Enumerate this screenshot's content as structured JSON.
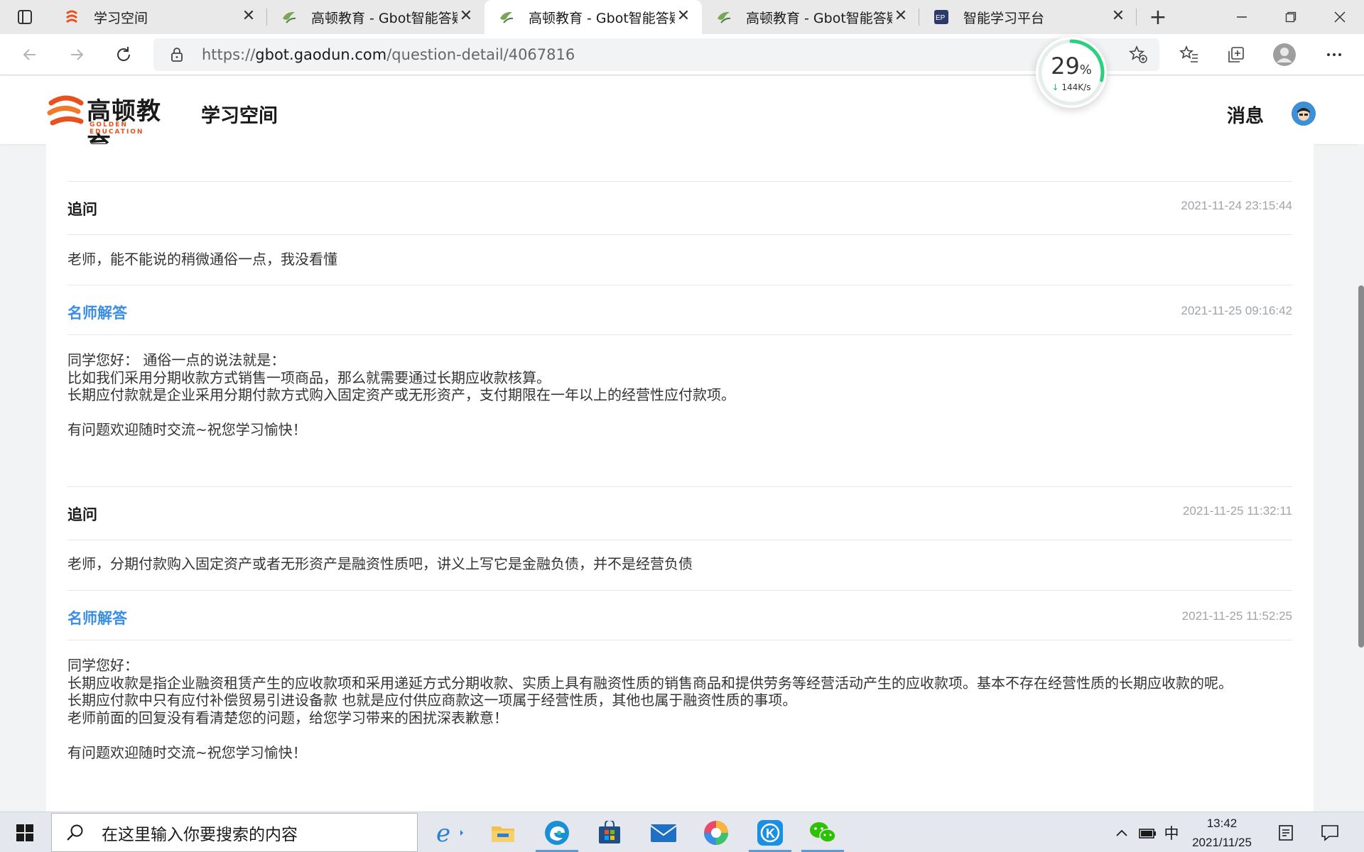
{
  "browser": {
    "tabs": [
      {
        "title": "学习空间",
        "icon": "gaodun-logo-icon",
        "active": false
      },
      {
        "title": "高顿教育 - Gbot智能答疑",
        "icon": "gbot-icon",
        "active": false
      },
      {
        "title": "高顿教育 - Gbot智能答疑",
        "icon": "gbot-icon",
        "active": true
      },
      {
        "title": "高顿教育 - Gbot智能答疑",
        "icon": "gbot-icon",
        "active": false
      },
      {
        "title": "智能学习平台",
        "icon": "ep-icon",
        "active": false
      }
    ],
    "close_glyph": "✕",
    "new_tab_glyph": "+",
    "url_prefix": "https://",
    "url_host": "gbot.gaodun.com",
    "url_path": "/question-detail/4067816",
    "speed_widget": {
      "percent": "29",
      "percent_unit": "%",
      "rate": "144K/s",
      "value": 0.29
    }
  },
  "site": {
    "logo_cn": "高顿教育",
    "logo_en": "GOLDEN EDUCATION",
    "name": "学习空间",
    "messages_label": "消息"
  },
  "thread": [
    {
      "kind": "followup",
      "label": "追问",
      "time": "2021-11-24 23:15:44",
      "lines": [
        "老师，能不能说的稍微通俗一点，我没看懂"
      ]
    },
    {
      "kind": "answer",
      "label": "名师解答",
      "time": "2021-11-25 09:16:42",
      "lines": [
        "同学您好： 通俗一点的说法就是：",
        "比如我们采用分期收款方式销售一项商品，那么就需要通过长期应收款核算。",
        "长期应付款就是企业采用分期付款方式购入固定资产或无形资产，支付期限在一年以上的经营性应付款项。",
        "",
        "有问题欢迎随时交流~祝您学习愉快！"
      ]
    },
    {
      "kind": "followup",
      "label": "追问",
      "time": "2021-11-25 11:32:11",
      "lines": [
        "老师，分期付款购入固定资产或者无形资产是融资性质吧，讲义上写它是金融负债，并不是经营负债"
      ]
    },
    {
      "kind": "answer",
      "label": "名师解答",
      "time": "2021-11-25 11:52:25",
      "lines": [
        "同学您好：",
        "长期应收款是指企业融资租赁产生的应收款项和采用递延方式分期收款、实质上具有融资性质的销售商品和提供劳务等经营活动产生的应收款项。基本不存在经营性质的长期应收款的呢。",
        "长期应付款中只有应付补偿贸易引进设备款 也就是应付供应商款这一项属于经营性质，其他也属于融资性质的事项。",
        "老师前面的回复没有看清楚您的问题，给您学习带来的困扰深表歉意！",
        "",
        "有问题欢迎随时交流~祝您学习愉快！"
      ]
    }
  ],
  "taskbar": {
    "search_placeholder": "在这里输入你要搜索的内容",
    "apps": [
      "internet-explorer",
      "file-explorer",
      "edge",
      "microsoft-store",
      "mail",
      "chrome-like",
      "kugou",
      "wechat"
    ],
    "ime": "中",
    "time": "13:42",
    "date": "2021/11/25"
  },
  "colors": {
    "accent": "#3a8ee6",
    "brand_orange": "#e8501c",
    "timestamp": "#a0a4ab"
  }
}
